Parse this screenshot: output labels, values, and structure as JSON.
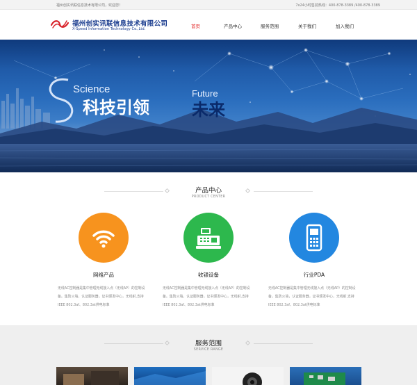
{
  "topbar": {
    "welcome": "福州创实讯联信息技术有限公司，欢迎您！",
    "hotline": "7x24小时售前热线：400-878-3389 /400-878-3389"
  },
  "header": {
    "company_cn": "福州创实讯联信息技术有限公司",
    "company_en": "X-Speed Information Technology Co.,Ltd.",
    "nav": [
      {
        "label": "首页"
      },
      {
        "label": "产品中心"
      },
      {
        "label": "服务范围"
      },
      {
        "label": "关于我们"
      },
      {
        "label": "加入我们"
      }
    ]
  },
  "banner": {
    "science": "Science",
    "kejiyinling": "科技引领",
    "future": "Future",
    "weilai": "未来"
  },
  "products": {
    "title": "产品中心",
    "subtitle": "PRODUCT CENTER",
    "items": [
      {
        "name": "网络产品",
        "icon": "wifi-icon",
        "color": "#f7931e",
        "desc": "无线AC控制器是集中管理无线接入点（无线AP）的控制设备。集防火墙，认证服务器，证书颁发中心，无线射,支持IEEE 802.3af、802.3at供电标准"
      },
      {
        "name": "收银设备",
        "icon": "cash-register-icon",
        "color": "#2db84d",
        "desc": "无线AC控制器是集中管理无线接入点（无线AP）的控制设备。集防火墙，认证服务器，证书颁发中心，无线射,支持IEEE 802.3af、802.3at供电标准"
      },
      {
        "name": "行业PDA",
        "icon": "pda-icon",
        "color": "#2387e0",
        "desc": "无线AC控制器是集中管理无线接入点（无线AP）的控制设备。集防火墙，认证服务器，证书颁发中心，无线射,支持IEEE 802.3af、802.3at供电标准"
      }
    ]
  },
  "services": {
    "title": "服务范围",
    "subtitle": "SERVICE RANGE"
  }
}
